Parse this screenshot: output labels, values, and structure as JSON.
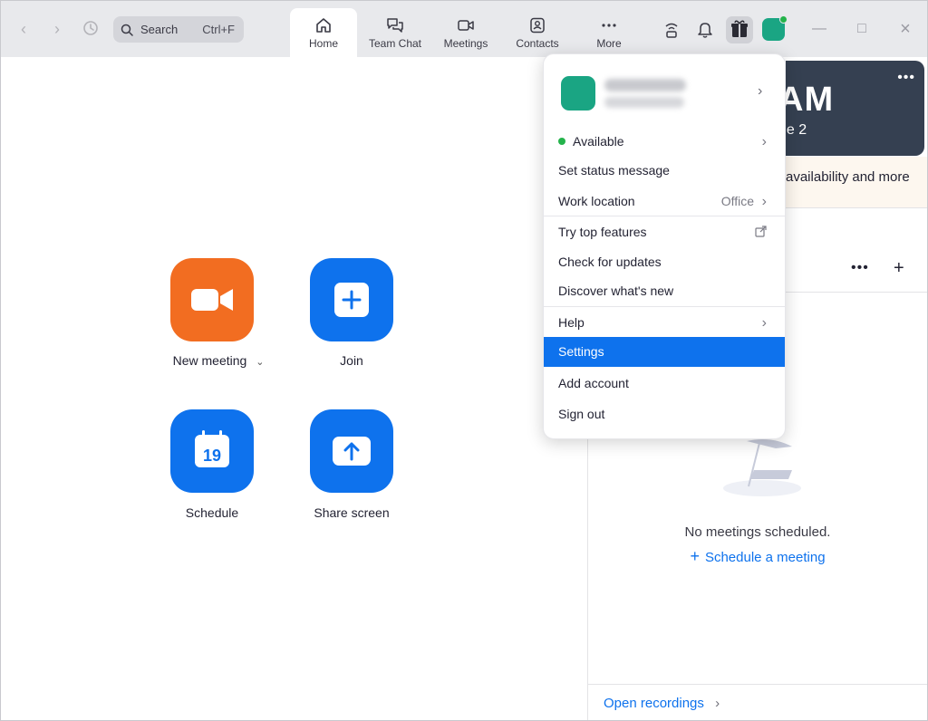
{
  "topbar": {
    "search_label": "Search",
    "search_shortcut": "Ctrl+F",
    "tabs": [
      {
        "label": "Home"
      },
      {
        "label": "Team Chat"
      },
      {
        "label": "Meetings"
      },
      {
        "label": "Contacts"
      },
      {
        "label": "More"
      }
    ]
  },
  "actions": {
    "new_meeting": "New meeting",
    "join": "Join",
    "schedule": "Schedule",
    "schedule_day": "19",
    "share_screen": "Share screen"
  },
  "banner": {
    "big": "AM",
    "sub": "ne 2"
  },
  "notice": "availability and more",
  "meetings_panel": {
    "empty_text": "No meetings scheduled.",
    "schedule_link": "Schedule a meeting",
    "open_recordings": "Open recordings"
  },
  "menu": {
    "available": "Available",
    "set_status": "Set status message",
    "work_location": "Work location",
    "work_location_value": "Office",
    "try_top_features": "Try top features",
    "check_updates": "Check for updates",
    "whats_new": "Discover what's new",
    "help": "Help",
    "settings": "Settings",
    "add_account": "Add account",
    "sign_out": "Sign out"
  },
  "colors": {
    "accent": "#0e72ed",
    "orange": "#f26d21",
    "avatar": "#1aa583",
    "status": "#24b34b",
    "banner": "#354051"
  }
}
